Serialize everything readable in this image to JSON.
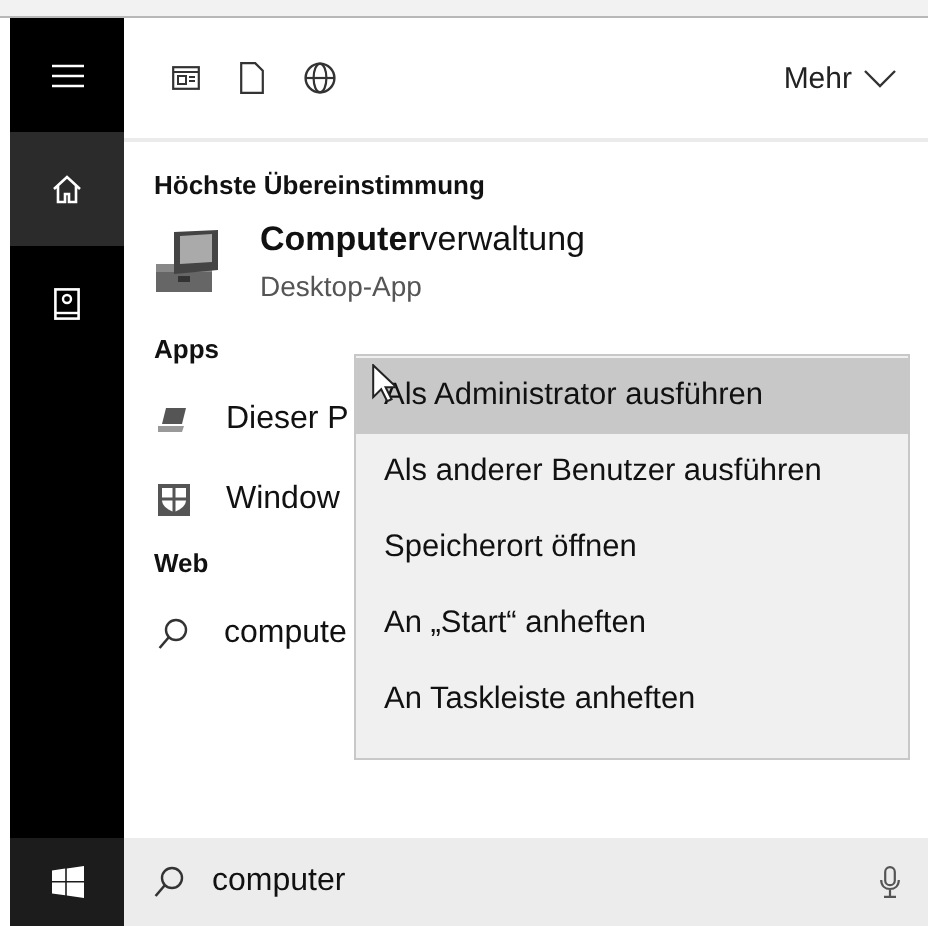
{
  "sidebar": {
    "items": [
      {
        "kind": "menu",
        "selected": false
      },
      {
        "kind": "home",
        "selected": true
      },
      {
        "kind": "notebook",
        "selected": false
      }
    ]
  },
  "toolbar": {
    "filters": [
      {
        "kind": "documents-view"
      },
      {
        "kind": "document"
      },
      {
        "kind": "web"
      }
    ],
    "more": "Mehr"
  },
  "sections": [
    {
      "heading": "Höchste Übereinstimmung",
      "items": [
        {
          "kind": "toolbox",
          "title": "**Computer**verwaltung",
          "subtitle": "Desktop-App"
        }
      ]
    },
    {
      "heading": "Apps",
      "items": [
        {
          "kind": "laptop",
          "title": "Dieser P"
        },
        {
          "kind": "shield",
          "title": "Window"
        }
      ]
    },
    {
      "heading": "Web",
      "items": [
        {
          "kind": "search",
          "title": "compute"
        }
      ]
    }
  ],
  "context_menu": {
    "items": [
      {
        "label": "Als Administrator ausführen",
        "selected": true
      },
      {
        "label": "Als anderer Benutzer ausführen",
        "selected": false
      },
      {
        "label": "Speicherort öffnen",
        "selected": false
      },
      {
        "label": "An „Start“ anheften",
        "selected": false
      },
      {
        "label": "An Taskleiste anheften",
        "selected": false
      }
    ]
  },
  "search_box": {
    "value": "computer"
  }
}
